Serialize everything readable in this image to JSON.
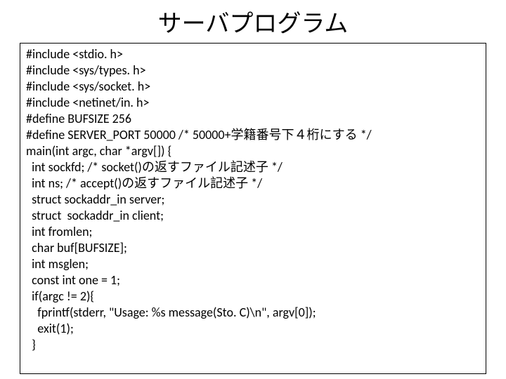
{
  "title": "サーバプログラム",
  "code": {
    "l0": "#include <stdio. h>",
    "l1": "#include <sys/types. h>",
    "l2": "#include <sys/socket. h>",
    "l3": "#include <netinet/in. h>",
    "l4": "#define BUFSIZE 256",
    "l5": "#define SERVER_PORT 50000 /* 50000+学籍番号下４桁にする */",
    "l6": "main(int argc, char *argv[]) {",
    "l7": "  int sockfd; /* socket()の返すファイル記述子 */",
    "l8": "  int ns; /* accept()の返すファイル記述子 */",
    "l9": "  struct sockaddr_in server;",
    "l10": "  struct  sockaddr_in client;",
    "l11": "  int fromlen;",
    "l12": "  char buf[BUFSIZE];",
    "l13": "  int msglen;",
    "l14": "  const int one = 1;",
    "l15": "  if(argc != 2){",
    "l16": "    fprintf(stderr, \"Usage: %s message(Sto. C)\\n\", argv[0]);",
    "l17": "    exit(1);",
    "l18": "  }"
  }
}
